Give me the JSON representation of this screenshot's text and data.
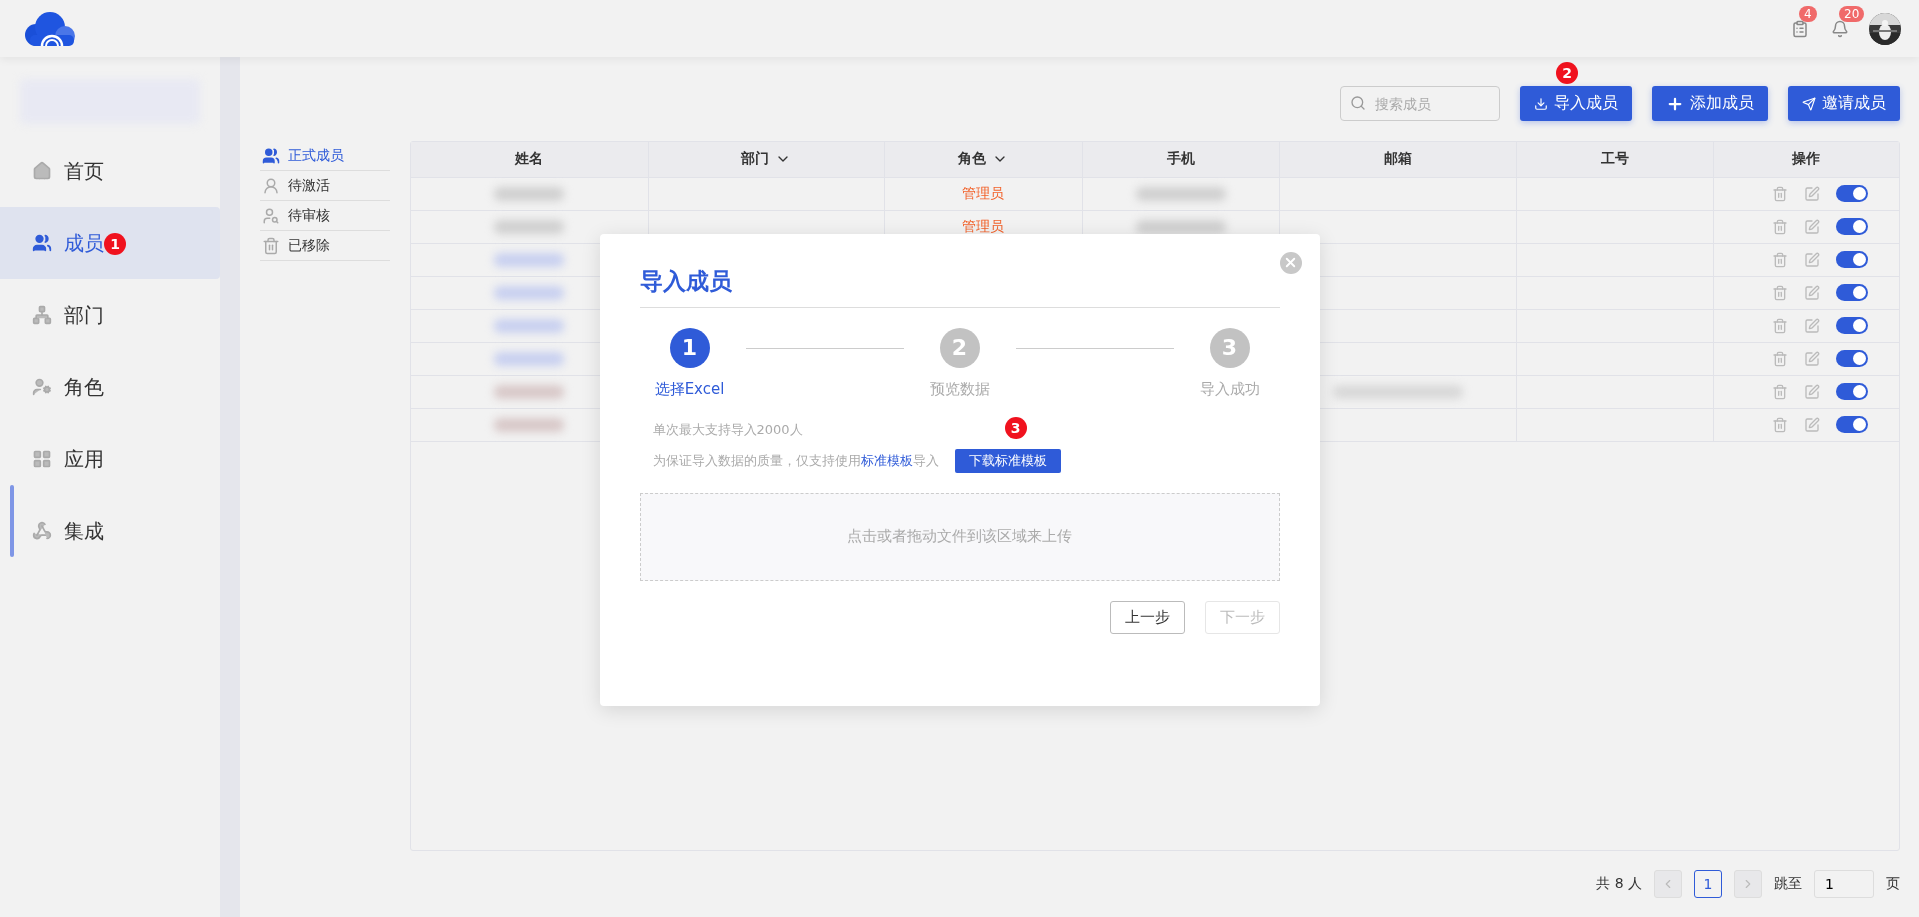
{
  "topbar": {
    "badges": [
      {
        "count": "4"
      },
      {
        "count": "20"
      }
    ]
  },
  "sidebar": {
    "items": [
      {
        "label": "首页",
        "selected": false
      },
      {
        "label": "成员",
        "selected": true,
        "marker": "1"
      },
      {
        "label": "部门",
        "selected": false
      },
      {
        "label": "角色",
        "selected": false
      },
      {
        "label": "应用",
        "selected": false
      },
      {
        "label": "集成",
        "selected": false
      }
    ]
  },
  "subnav": [
    {
      "label": "正式成员",
      "selected": true
    },
    {
      "label": "待激活",
      "selected": false
    },
    {
      "label": "待审核",
      "selected": false
    },
    {
      "label": "已移除",
      "selected": false
    }
  ],
  "toolbar": {
    "search": {
      "placeholder": "搜索成员"
    },
    "buttons": [
      {
        "label": "导入成员",
        "marker": "2"
      },
      {
        "label": "添加成员"
      },
      {
        "label": "邀请成员"
      }
    ]
  },
  "table": {
    "columns": [
      {
        "label": "姓名",
        "dropdown": false
      },
      {
        "label": "部门",
        "dropdown": true
      },
      {
        "label": "角色",
        "dropdown": true
      },
      {
        "label": "手机",
        "dropdown": false
      },
      {
        "label": "邮箱",
        "dropdown": false
      },
      {
        "label": "工号",
        "dropdown": false
      },
      {
        "label": "操作",
        "dropdown": false
      }
    ],
    "rows": [
      {
        "role": "管理员",
        "on": true
      },
      {
        "role": "管理员",
        "on": true
      },
      {
        "on": true
      },
      {
        "on": true
      },
      {
        "on": true
      },
      {
        "on": true
      },
      {
        "on": true
      },
      {
        "on": true
      }
    ]
  },
  "pagination": {
    "total": "共 8 人",
    "pages": [
      {
        "label": "1",
        "selected": true
      }
    ],
    "jump_label": "跳至",
    "jump_value": "1",
    "suffix": "页"
  },
  "dialog": {
    "title": "导入成员",
    "steps": [
      {
        "number": "1",
        "label": "选择Excel",
        "selected": true
      },
      {
        "number": "2",
        "label": "预览数据",
        "selected": false
      },
      {
        "number": "3",
        "label": "导入成功",
        "selected": false
      }
    ],
    "limit_note": "单次最大支持导入2000人",
    "template_note": {
      "before": "为保证导入数据的质量，仅支持使用",
      "link": "标准模板",
      "after": "导入"
    },
    "download_button": {
      "label": "下载标准模板",
      "marker": "3"
    },
    "dropzone": "点击或者拖动文件到该区域来上传",
    "buttons": [
      {
        "label": "上一步",
        "disabled": false
      },
      {
        "label": "下一步",
        "disabled": true
      }
    ]
  }
}
